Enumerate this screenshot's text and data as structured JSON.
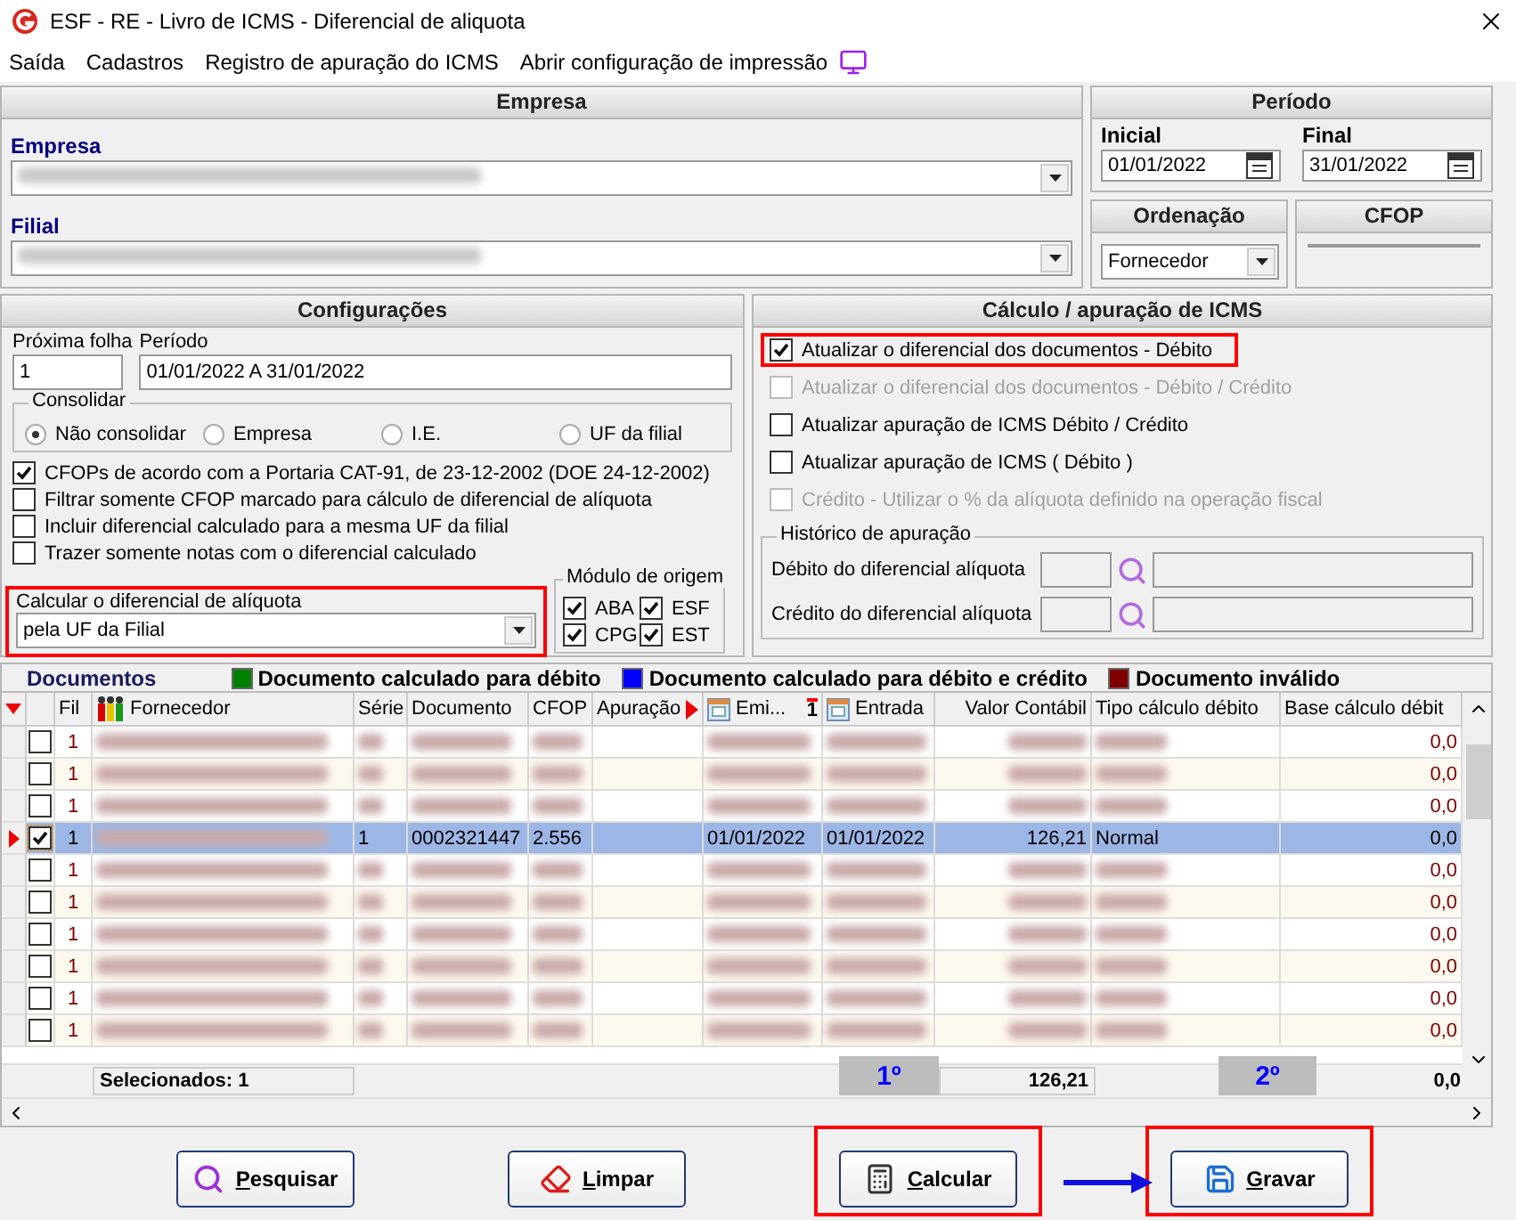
{
  "window": {
    "title": "ESF - RE - Livro de ICMS - Diferencial de aliquota"
  },
  "menu": [
    {
      "label": "Saída"
    },
    {
      "label": "Cadastros"
    },
    {
      "label": "Registro de apuração do ICMS"
    },
    {
      "label": "Abrir configuração de impressão"
    }
  ],
  "empresa_panel": {
    "title": "Empresa",
    "fields": [
      {
        "label": "Empresa"
      },
      {
        "label": "Filial"
      }
    ]
  },
  "periodo": {
    "title": "Período",
    "fields": [
      {
        "label": "Inicial",
        "value": "01/01/2022"
      },
      {
        "label": "Final",
        "value": "31/01/2022"
      }
    ]
  },
  "ordenacao": {
    "title": "Ordenação",
    "value": "Fornecedor"
  },
  "cfop": {
    "title": "CFOP"
  },
  "configuracoes": {
    "title": "Configurações",
    "proxima_folha": {
      "label": "Próxima folha",
      "value": "1"
    },
    "periodo": {
      "label": "Período",
      "value": "01/01/2022 A 31/01/2022"
    },
    "consolidar": {
      "title": "Consolidar",
      "options": [
        {
          "label": "Não consolidar",
          "selected": true
        },
        {
          "label": "Empresa",
          "selected": false
        },
        {
          "label": "I.E.",
          "selected": false
        },
        {
          "label": "UF da filial",
          "selected": false
        }
      ]
    },
    "checks": [
      {
        "label": "CFOPs de acordo com a Portaria CAT-91, de 23-12-2002 (DOE 24-12-2002)",
        "checked": true
      },
      {
        "label": "Filtrar somente CFOP marcado para cálculo de diferencial de alíquota",
        "checked": false
      },
      {
        "label": "Incluir diferencial calculado para a mesma UF da filial",
        "checked": false
      },
      {
        "label": "Trazer somente notas com o diferencial calculado",
        "checked": false
      }
    ],
    "calcular": {
      "label": "Calcular o diferencial de alíquota",
      "value": "pela UF da Filial",
      "highlighted": true
    },
    "modulo": {
      "title": "Módulo de origem",
      "items": [
        {
          "label": "ABA",
          "checked": true
        },
        {
          "label": "ESF",
          "checked": true
        },
        {
          "label": "CPG",
          "checked": true
        },
        {
          "label": "EST",
          "checked": true
        }
      ]
    }
  },
  "calculo": {
    "title": "Cálculo / apuração de ICMS",
    "checks": [
      {
        "label": "Atualizar o diferencial dos documentos - Débito",
        "checked": true,
        "disabled": false,
        "highlighted": true
      },
      {
        "label": "Atualizar o diferencial dos documentos - Débito / Crédito",
        "checked": false,
        "disabled": true,
        "highlighted": false
      },
      {
        "label": "Atualizar apuração de ICMS Débito / Crédito",
        "checked": false,
        "disabled": false,
        "highlighted": false
      },
      {
        "label": "Atualizar apuração de ICMS ( Débito )",
        "checked": false,
        "disabled": false,
        "highlighted": false
      },
      {
        "label": "Crédito - Utilizar o % da alíquota definido na operação fiscal",
        "checked": false,
        "disabled": true,
        "highlighted": false
      }
    ],
    "historico": {
      "title": "Histórico de apuração",
      "fields": [
        {
          "label": "Débito do diferencial alíquota"
        },
        {
          "label": "Crédito do diferencial alíquota"
        }
      ]
    }
  },
  "documentos": {
    "title": "Documentos",
    "legend": [
      {
        "label": "Documento calculado para débito",
        "color": "#008000"
      },
      {
        "label": "Documento calculado para débito e crédito",
        "color": "#0000ff"
      },
      {
        "label": "Documento inválido",
        "color": "#800000"
      }
    ],
    "columns": [
      {
        "label": "Fil"
      },
      {
        "label": "Fornecedor"
      },
      {
        "label": "Série"
      },
      {
        "label": "Documento"
      },
      {
        "label": "CFOP"
      },
      {
        "label": "Apuração"
      },
      {
        "label": "Emi...",
        "sort_index": "1"
      },
      {
        "label": "Entrada"
      },
      {
        "label": "Valor Contábil"
      },
      {
        "label": "Tipo cálculo débito"
      },
      {
        "label": "Base cálculo débit"
      }
    ],
    "rows": [
      {
        "fil": "1",
        "checked": false,
        "selected": false,
        "obscured": true,
        "base": "0,0"
      },
      {
        "fil": "1",
        "checked": false,
        "selected": false,
        "obscured": true,
        "base": "0,0"
      },
      {
        "fil": "1",
        "checked": false,
        "selected": false,
        "obscured": true,
        "base": "0,0"
      },
      {
        "fil": "1",
        "checked": true,
        "selected": true,
        "obscured": false,
        "serie": "1",
        "documento": "0002321447",
        "cfop": "2.556",
        "emissao": "01/01/2022",
        "entrada": "01/01/2022",
        "valor": "126,21",
        "tipo": "Normal",
        "base": "0,0"
      },
      {
        "fil": "1",
        "checked": false,
        "selected": false,
        "obscured": true,
        "base": "0,0"
      },
      {
        "fil": "1",
        "checked": false,
        "selected": false,
        "obscured": true,
        "base": "0,0"
      },
      {
        "fil": "1",
        "checked": false,
        "selected": false,
        "obscured": true,
        "base": "0,0"
      },
      {
        "fil": "1",
        "checked": false,
        "selected": false,
        "obscured": true,
        "base": "0,0"
      },
      {
        "fil": "1",
        "checked": false,
        "selected": false,
        "obscured": true,
        "base": "0,0"
      },
      {
        "fil": "1",
        "checked": false,
        "selected": false,
        "obscured": true,
        "base": "0,0"
      }
    ],
    "footer": {
      "selected_count": "Selecionados: 1",
      "valor": "126,21",
      "base": "0,0"
    },
    "markers": [
      {
        "label": "1º"
      },
      {
        "label": "2º"
      }
    ]
  },
  "buttons": [
    {
      "label": "Pesquisar",
      "highlighted": false
    },
    {
      "label": "Limpar",
      "highlighted": false
    },
    {
      "label": "Calcular",
      "highlighted": true
    },
    {
      "label": "Gravar",
      "highlighted": true
    }
  ]
}
